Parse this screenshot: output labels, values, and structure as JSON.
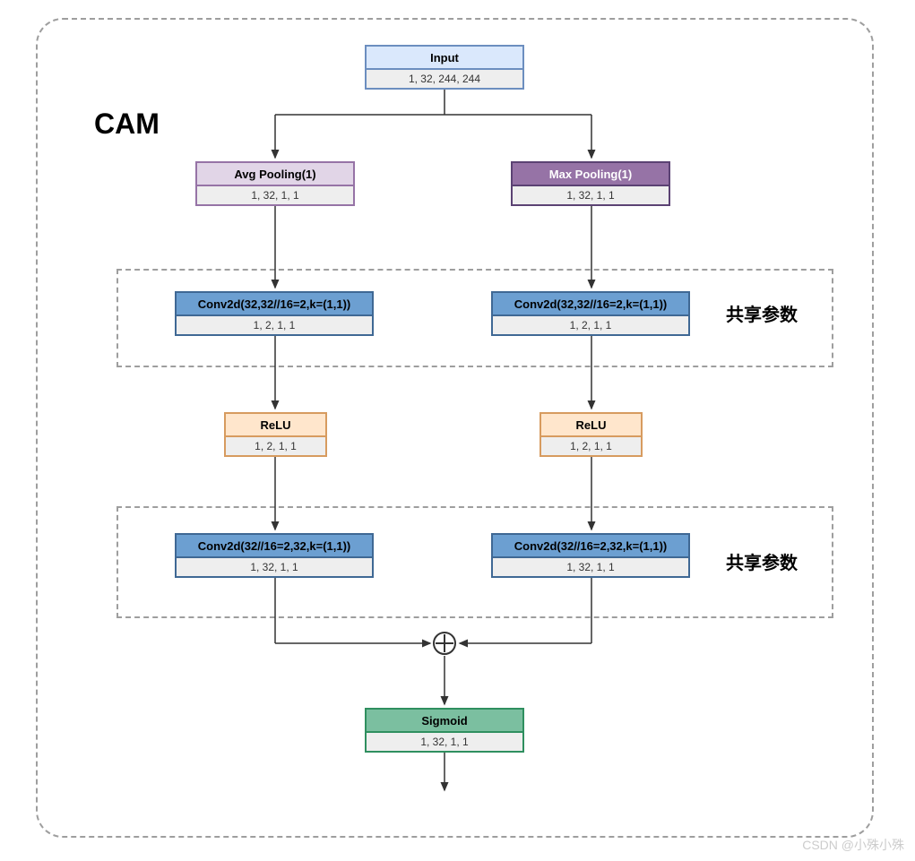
{
  "title": "CAM",
  "shared_label_1": "共享参数",
  "shared_label_2": "共享参数",
  "watermark": "CSDN @小殊小殊",
  "nodes": {
    "input": {
      "title": "Input",
      "shape": "1, 32, 244, 244"
    },
    "avg": {
      "title": "Avg Pooling(1)",
      "shape": "1, 32, 1, 1"
    },
    "max": {
      "title": "Max Pooling(1)",
      "shape": "1, 32, 1, 1"
    },
    "conv1L": {
      "title": "Conv2d(32,32//16=2,k=(1,1))",
      "shape": "1, 2, 1, 1"
    },
    "conv1R": {
      "title": "Conv2d(32,32//16=2,k=(1,1))",
      "shape": "1, 2, 1, 1"
    },
    "reluL": {
      "title": "ReLU",
      "shape": "1, 2, 1, 1"
    },
    "reluR": {
      "title": "ReLU",
      "shape": "1, 2, 1, 1"
    },
    "conv2L": {
      "title": "Conv2d(32//16=2,32,k=(1,1))",
      "shape": "1, 32, 1, 1"
    },
    "conv2R": {
      "title": "Conv2d(32//16=2,32,k=(1,1))",
      "shape": "1, 32, 1, 1"
    },
    "sigmoid": {
      "title": "Sigmoid",
      "shape": "1, 32, 1, 1"
    }
  }
}
